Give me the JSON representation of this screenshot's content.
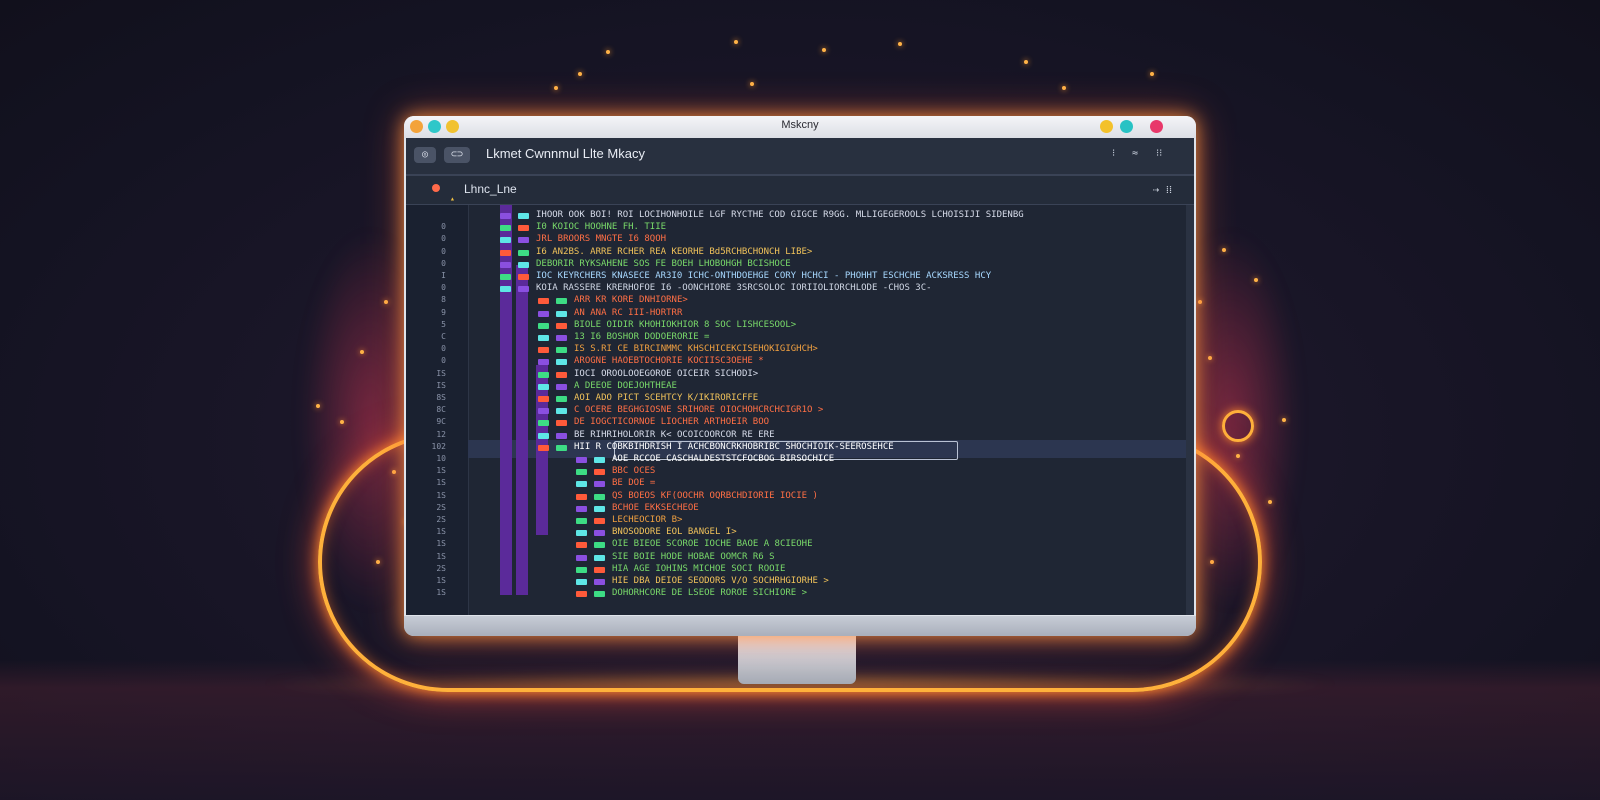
{
  "window": {
    "title": "Mskcny",
    "traffic_left": [
      "#f3a33a",
      "#2fc7c9",
      "#f1c230"
    ],
    "traffic_right": [
      "#f3c12a",
      "#28c2c4",
      "#e8386a"
    ]
  },
  "toolbar": {
    "back_glyph": "◎",
    "fwd_glyph": "⊂⊃",
    "app_title": "Lkmet Cwnnmul Llte Mkacy",
    "right_glyphs": [
      "⁝",
      "≈",
      "⁝⁝"
    ]
  },
  "tab": {
    "label": "Lhnc_Lne",
    "tools": "⇢  ⁞⁞"
  },
  "editor": {
    "line_numbers": [
      "",
      "0",
      "0",
      "0",
      "0",
      "I",
      "0",
      "8",
      "9",
      "5",
      "C",
      "0",
      "0",
      "IS",
      "IS",
      "8S",
      "8C",
      "9C",
      "12",
      "102",
      "10",
      "1S",
      "1S",
      "1S",
      "2S",
      "2S",
      "1S",
      "1S",
      "1S",
      "2S",
      "1S",
      "1S"
    ],
    "lines": [
      {
        "text": "IHOOR OOK  BOI!  ROI  LOCIHONHOILE LGF RYCTHE COD GIGCE R9GG. MLLIGEGEROOLS LCHOISIJI SIDENBG",
        "color": "#d7dcea"
      },
      {
        "text": "I0 KOIOC HOOHNE FH. TIIE",
        "color": "#79d96a"
      },
      {
        "text": "JRL  BROORS   MNGTE I6 8QOH",
        "color": "#ff6f45"
      },
      {
        "text": "I6 AN2BS. ARRE  RCHER REA KEORHE Bd5RCHBCHONCH LIBE>",
        "color": "#f0c25a"
      },
      {
        "text": "DEBORIR RYKSAHENE SOS FE BOEH LHOBOHGH BCISHOCE",
        "color": "#79d96a"
      },
      {
        "text": "IOC KEYRCHERS KNASECE AR3I0 ICHC-ONTHDOEHGE CORY  HCHCI  - PHOHHT ESCHCHE ACKSRESS HCY",
        "color": "#a7d8ff"
      },
      {
        "text": "KOIA RASSERE KRERHOFOE I6 -OONCHIORE 3SRCSOLOC IORIIOLIORCHLODE -CHOS 3C-",
        "color": "#cfd6e4"
      },
      {
        "text": "ARR  KR  KORE  DNHIORNE>",
        "color": "#ff6f45"
      },
      {
        "text": "AN  ANA  RC  III-HORTRR",
        "color": "#ff6f45"
      },
      {
        "text": "BIOLE  OIDIR  KHOHIOKHIOR  8 SOC  LISHCESOOL>",
        "color": "#79d96a"
      },
      {
        "text": "13  I6  BOSHOR DODOERORIE   =",
        "color": "#79d96a"
      },
      {
        "text": "IS  S.RI  CE  BIRCINMMC  KHSCHICEKCISEHOKIGIGHCH>",
        "color": "#f0a040"
      },
      {
        "text": "AROGNE  HAOEBTOCHORIE  KOCIISC3OEHE   *",
        "color": "#ff6f45"
      },
      {
        "text": "IOCI OROOLOOEGOROE OICEIR  SICHODI>",
        "color": "#d7dcea"
      },
      {
        "text": "A DEEOE DOEJOHTHEAE",
        "color": "#79d96a"
      },
      {
        "text": "AOI  ADO  PICT  SCEHTCY  K/IKIRORICFFE",
        "color": "#f0c25a"
      },
      {
        "text": "C OCERE  BEGHGIOSNE  SRIHORE  OIOCHOHCRCHCIGR1O >",
        "color": "#ff6f45"
      },
      {
        "text": "DE IOGCTICORNOE  LIOCHER ARTHOEIR BOO",
        "color": "#ff6f45"
      },
      {
        "text": "BE RIHRIHOLORIR  K< OCOICOORCOR  RE  ERE",
        "color": "#d7dcea"
      },
      {
        "text": "HII R  COBKBIHDRISH  I ACHCBONCRKHOBRIBC  SHOCHIOIK-SEEROSEHCE",
        "color": "#ffffff"
      },
      {
        "text": "AOE  RCCOE  CASCHALDESTSTCFOCBOG  BIRSOCHICE",
        "color": "#ffffff"
      },
      {
        "text": "BBC OCES",
        "color": "#ff6f45"
      },
      {
        "text": "BE  DOE  =",
        "color": "#ff6f45"
      },
      {
        "text": "QS  BOEOS  KF(OOCHR  OQRBCHDIORIE  IOCIE  )",
        "color": "#ff6f45"
      },
      {
        "text": "BCHOE  EKKSECHEOE",
        "color": "#ff6f45"
      },
      {
        "text": "LECHEOCIOR  B>",
        "color": "#f0a040"
      },
      {
        "text": "BNOSODORE  EOL  BANGEL   I>",
        "color": "#f0c25a"
      },
      {
        "text": "OIE  BIEOE  SCOROE  IOCHE  BAOE  A  8CIEOHE",
        "color": "#79d96a"
      },
      {
        "text": "SIE  BOIE  HODE  HOBAE  OOMCR  R6  S",
        "color": "#79d96a"
      },
      {
        "text": "HIA  AGE  IOHINS  MICHOE  SOCI  ROOIE",
        "color": "#79d96a"
      },
      {
        "text": "HIE  DBA  DEIOE  SEODORS  V/O  SOCHRHGIORHE  >",
        "color": "#f0c25a"
      },
      {
        "text": "DOHORHCORE  DE  LSEOE  ROROE  SICHIORE  >",
        "color": "#79d96a"
      }
    ]
  },
  "colors": {
    "accent_neon": "#ffb13b",
    "editor_bg": "#1f2634",
    "chip_violet": "#8a4fe0",
    "chip_green": "#3ddc84",
    "chip_cyan": "#5ee6e6",
    "chip_red": "#ff5a3a"
  }
}
